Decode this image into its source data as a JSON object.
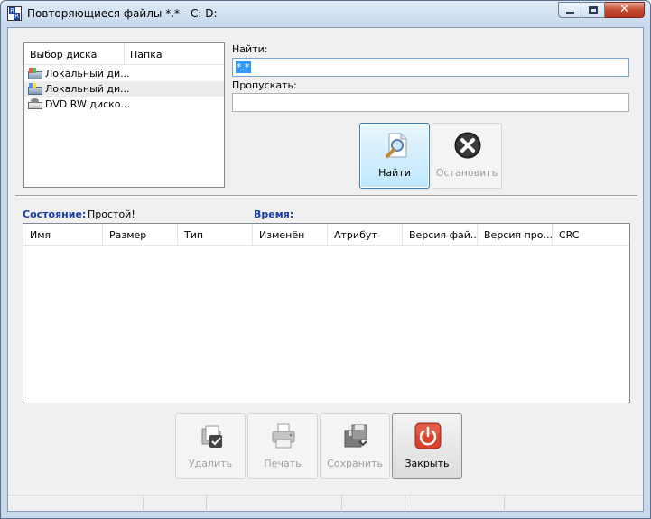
{
  "window": {
    "title": "Повторяющиеся файлы *.* - C: D:",
    "app_icon_text_a": "R",
    "app_icon_text_b": "R",
    "close_glyph": "✕"
  },
  "disk_panel": {
    "columns": [
      "Выбор диска",
      "Папка"
    ],
    "items": [
      {
        "label": "Локальный ди...",
        "icon": "windows-drive-icon",
        "selected": false
      },
      {
        "label": "Локальный ди...",
        "icon": "windows-drive-icon",
        "selected": true
      },
      {
        "label": "DVD RW диско...",
        "icon": "dvd-drive-icon",
        "selected": false
      }
    ]
  },
  "find": {
    "find_label": "Найти:",
    "find_value": "*.*",
    "skip_label": "Пропускать:",
    "skip_value": ""
  },
  "actions": {
    "find_button": "Найти",
    "stop_button": "Остановить"
  },
  "status": {
    "state_label": "Состояние:",
    "state_value": "Простой!",
    "time_label": "Время:",
    "time_value": ""
  },
  "results": {
    "columns": [
      "Имя",
      "Размер",
      "Тип",
      "Изменён",
      "Атрибут",
      "Версия фай...",
      "Версия про...",
      "CRC"
    ],
    "rows": []
  },
  "bottom_buttons": {
    "delete": "Удалить",
    "print": "Печать",
    "save": "Сохранить",
    "close": "Закрыть"
  },
  "colors": {
    "accent_label": "#1a3d9c",
    "close_button": "#d9432d"
  }
}
